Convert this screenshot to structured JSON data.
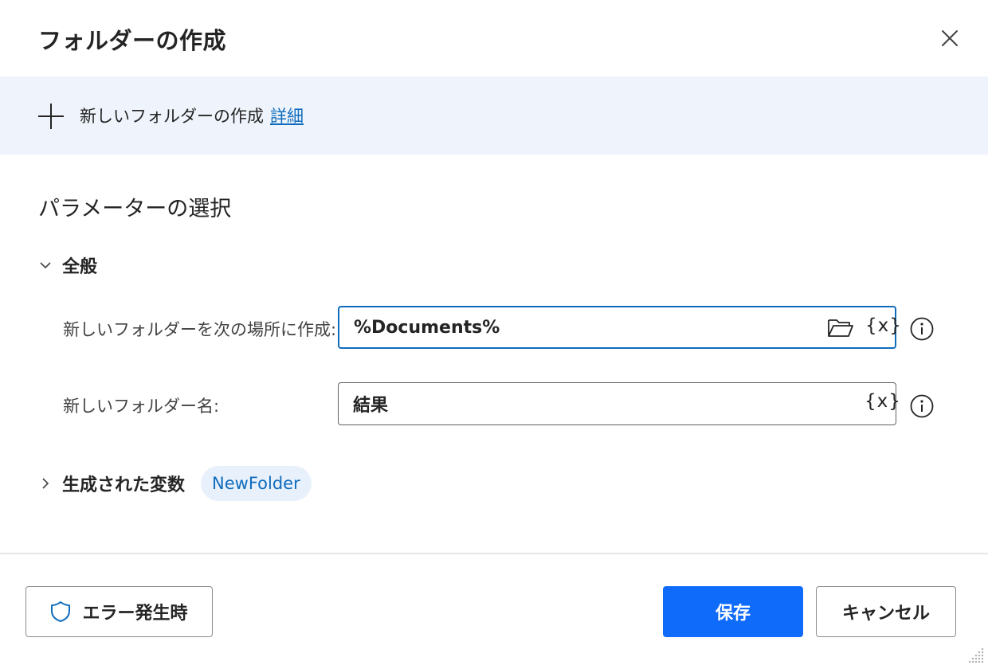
{
  "dialog": {
    "title": "フォルダーの作成",
    "close_icon": "close-icon"
  },
  "banner": {
    "icon": "plus-icon",
    "description": "新しいフォルダーの作成",
    "link_label": "詳細"
  },
  "parameters": {
    "title": "パラメーターの選択",
    "general_group": {
      "label": "全般",
      "expanded": true,
      "fields": [
        {
          "label": "新しいフォルダーを次の場所に作成:",
          "value": "%Documents%",
          "has_folder_picker": true,
          "variable_icon": "{x}",
          "focused": true
        },
        {
          "label": "新しいフォルダー名:",
          "value": "結果",
          "has_folder_picker": false,
          "variable_icon": "{x}",
          "focused": false
        }
      ]
    },
    "variables_group": {
      "label": "生成された変数",
      "expanded": false,
      "variables": [
        "NewFolder"
      ]
    }
  },
  "footer": {
    "error_button_label": "エラー発生時",
    "save_label": "保存",
    "cancel_label": "キャンセル"
  },
  "colors": {
    "accent": "#0f6cbd",
    "primary_button": "#0f6cfb",
    "banner_bg": "#eff4fc",
    "chip_bg": "#e8f1fb"
  }
}
